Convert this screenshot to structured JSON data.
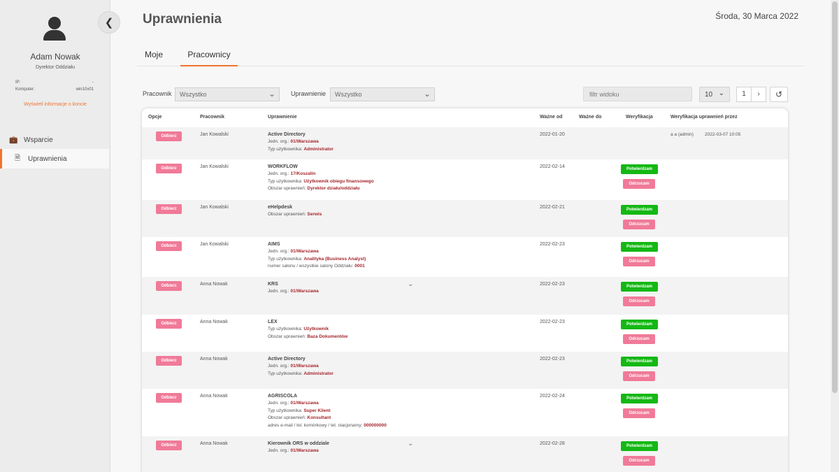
{
  "sidebar": {
    "user_name": "Adam Nowak",
    "user_role": "Dyrektor Oddziału",
    "ip_label": "IP:",
    "ip_value": "-",
    "computer_label": "Komputer:",
    "computer_value": "win10x01",
    "info_link": "Wyświetl informacje o koncie",
    "items": [
      {
        "label": "Wsparcie",
        "icon": "briefcase-icon"
      },
      {
        "label": "Uprawnienia",
        "icon": "document-icon"
      }
    ]
  },
  "header": {
    "title": "Uprawnienia",
    "date": "Środa, 30 Marca 2022"
  },
  "tabs": [
    "Moje",
    "Pracownicy"
  ],
  "filters": {
    "employee_label": "Pracownik",
    "employee_value": "Wszystko",
    "permission_label": "Uprawnienie",
    "permission_value": "Wszystko",
    "view_filter_placeholder": "filtr widoku",
    "page_size": "10",
    "page": "1"
  },
  "table": {
    "headers": [
      "Opcje",
      "Pracownik",
      "Uprawnienie",
      "Ważne od",
      "Ważne do",
      "Weryfikacja",
      "Weryfikacja uprawnień przez"
    ],
    "button_labels": {
      "odbierz": "Odbierz",
      "potwierdzam": "Potwierdzam",
      "odrzucam": "Odrzucam"
    },
    "rows": [
      {
        "employee": "Jan Kowalski",
        "title": "Active Directory",
        "details": [
          {
            "label": "Jedn. org.: ",
            "value": "01/Warszawa"
          },
          {
            "label": "Typ użytkownika: ",
            "value": "Administrator"
          }
        ],
        "valid_from": "2022-01-20",
        "verified_by": "a a (admin)",
        "verified_at": "2022-03-07 10:05"
      },
      {
        "employee": "Jan Kowalski",
        "title": "WORKFLOW",
        "details": [
          {
            "label": "Jedn. org.: ",
            "value": "17/Koszalin"
          },
          {
            "label": "Typ użytkownika: ",
            "value": "Użytkownik obiegu finansowego"
          },
          {
            "label": "Obszar uprawnień: ",
            "value": "Dyrektor działu/oddziału"
          }
        ],
        "valid_from": "2022-02-14"
      },
      {
        "employee": "Jan Kowalski",
        "title": "eHelpdesk",
        "details": [
          {
            "label": "Obszar uprawnień: ",
            "value": "Serwis"
          }
        ],
        "valid_from": "2022-02-21"
      },
      {
        "employee": "Jan Kowalski",
        "title": "AIMS",
        "details": [
          {
            "label": "Jedn. org.: ",
            "value": "01/Warszawa"
          },
          {
            "label": "Typ użytkownika: ",
            "value": "Analityka (Business Analyst)"
          },
          {
            "label": "numer salonu / wszystkie salony Oddziału: ",
            "value": "0001"
          }
        ],
        "valid_from": "2022-02-23"
      },
      {
        "employee": "Anna Nowak",
        "title": "KRS",
        "details": [
          {
            "label": "Jedn. org.: ",
            "value": "01/Warszawa"
          }
        ],
        "valid_from": "2022-02-23",
        "expandable": true
      },
      {
        "employee": "Anna Nowak",
        "title": "LEX",
        "details": [
          {
            "label": "Typ użytkownika: ",
            "value": "Użytkownik"
          },
          {
            "label": "Obszar uprawnień: ",
            "value": "Baza Dokumentów"
          }
        ],
        "valid_from": "2022-02-23"
      },
      {
        "employee": "Anna Nowak",
        "title": "Active Directory",
        "details": [
          {
            "label": "Jedn. org.: ",
            "value": "01/Warszawa"
          },
          {
            "label": "Typ użytkownika: ",
            "value": "Administrator"
          }
        ],
        "valid_from": "2022-02-23"
      },
      {
        "employee": "Anna Nowak",
        "title": "AGRISCOLA",
        "details": [
          {
            "label": "Jedn. org.: ",
            "value": "01/Warszawa"
          },
          {
            "label": "Typ użytkownika: ",
            "value": "Super Klient"
          },
          {
            "label": "Obszar uprawnień: ",
            "value": "Konsultant"
          },
          {
            "label": "adres e-mail / tel. komórkowy / tel. stacjonarny: ",
            "value": "000000000"
          }
        ],
        "valid_from": "2022-02-24"
      },
      {
        "employee": "Anna Nowak",
        "title": "Kierownik ORS w oddziale",
        "details": [
          {
            "label": "Jedn. org.: ",
            "value": "01/Warszawa"
          }
        ],
        "valid_from": "2022-02-28",
        "expandable": true
      }
    ]
  },
  "colors": {
    "accent": "#f0742f",
    "pink_button": "#f07a98",
    "green_button": "#14b814",
    "detail_value": "#a4262c"
  }
}
